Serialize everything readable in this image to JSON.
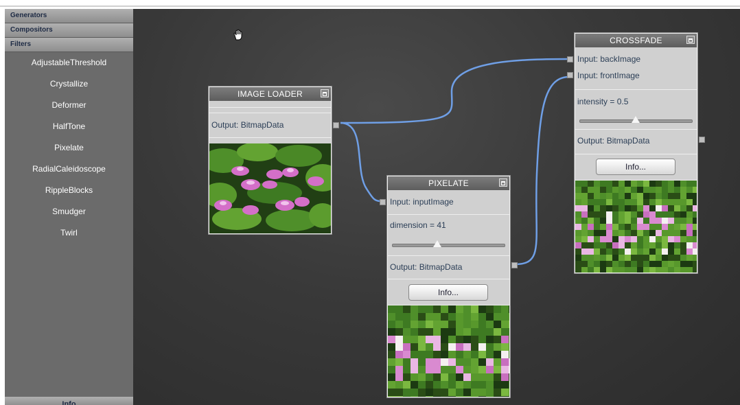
{
  "sidebar": {
    "sections": [
      "Generators",
      "Compositors",
      "Filters"
    ],
    "filters": [
      "AdjustableThreshold",
      "Crystallize",
      "Deformer",
      "HalfTone",
      "Pixelate",
      "RadialCaleidoscope",
      "RippleBlocks",
      "Smudger",
      "Twirl"
    ],
    "bottom_label": "Info"
  },
  "nodes": {
    "image_loader": {
      "title": "IMAGE LOADER",
      "output": "Output: BitmapData"
    },
    "pixelate": {
      "title": "PIXELATE",
      "input": "Input: inputImage",
      "param": "dimension = 41",
      "param_value": 0.38,
      "output": "Output: BitmapData",
      "info": "Info..."
    },
    "crossfade": {
      "title": "CROSSFADE",
      "input1": "Input: backImage",
      "input2": "Input: frontImage",
      "param": "intensity = 0.5",
      "param_value": 0.5,
      "output": "Output: BitmapData",
      "info": "Info..."
    }
  },
  "colors": {
    "wire": "#6f9fe6",
    "canvas": "#3a3a3a",
    "sidebar": "#6b6b6b"
  }
}
